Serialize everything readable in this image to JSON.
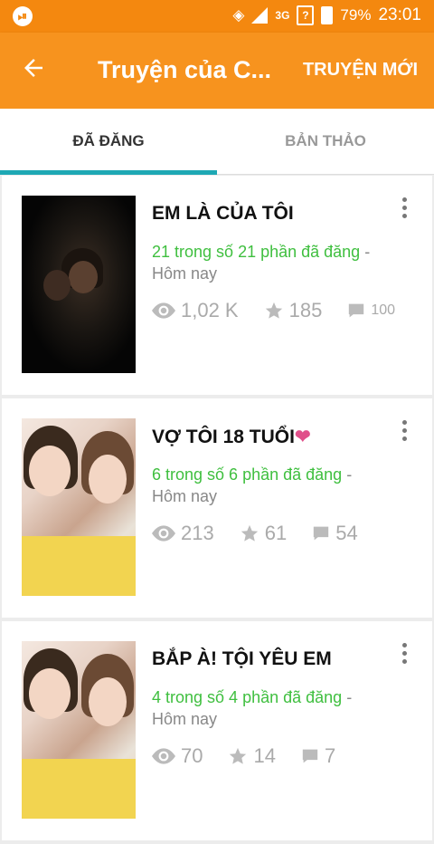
{
  "status_bar": {
    "battery": "79%",
    "time": "23:01",
    "network": "3G"
  },
  "app_bar": {
    "title": "Truyện của C...",
    "new_story_label": "TRUYỆN MỚI"
  },
  "tabs": [
    {
      "label": "ĐÃ ĐĂNG",
      "active": true
    },
    {
      "label": "BẢN THẢO",
      "active": false
    }
  ],
  "stories": [
    {
      "title": "EM LÀ CỦA TÔI",
      "parts": "21 trong số 21 phần đã đăng",
      "separator": " -",
      "date": "Hôm nay",
      "views": "1,02 K",
      "votes": "185",
      "comments": "100"
    },
    {
      "title": "VỢ TÔI 18 TUỔI",
      "parts": "6 trong số 6 phần đã đăng",
      "separator": " -",
      "date": "Hôm nay",
      "views": "213",
      "votes": "61",
      "comments": "54"
    },
    {
      "title": "BẮP À! TỘI YÊU EM",
      "parts": "4 trong số 4 phần đã đăng",
      "separator": " -",
      "date": "Hôm nay",
      "views": "70",
      "votes": "14",
      "comments": "7"
    }
  ],
  "colors": {
    "status_bar": "#f4880f",
    "app_bar": "#f7931e",
    "tab_indicator": "#1ea8b4",
    "parts_text": "#3fbf3f"
  }
}
